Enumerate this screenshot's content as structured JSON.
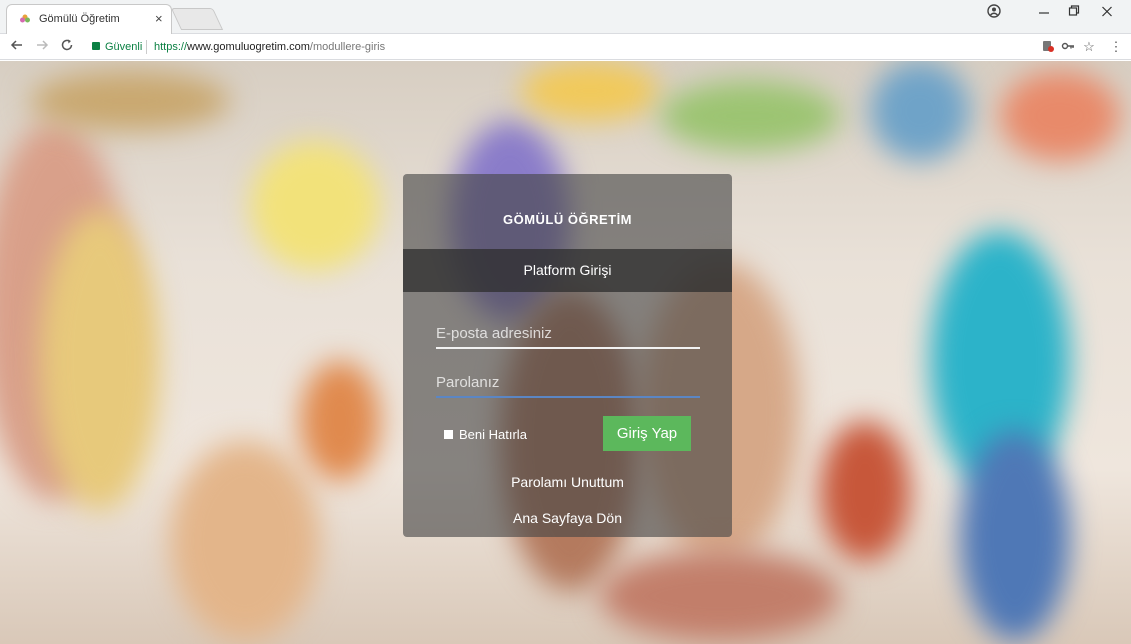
{
  "browser": {
    "tab_title": "Gömülü Öğretim",
    "tab_close": "×",
    "secure_label": "Güvenli",
    "url_scheme": "https://",
    "url_host": "www.gomuluogretim.com",
    "url_path": "/modullere-giris"
  },
  "login": {
    "brand": "GÖMÜLÜ ÖĞRETİM",
    "header": "Platform Girişi",
    "email_placeholder": "E-posta adresiniz",
    "password_placeholder": "Parolanız",
    "remember_label": "Beni Hatırla",
    "submit_label": "Giriş Yap",
    "forgot_link": "Parolamı Unuttum",
    "home_link": "Ana Sayfaya Dön"
  },
  "colors": {
    "submit_button": "#5cb85c",
    "secure": "#0b8043",
    "password_focus_underline": "#5b86c4"
  },
  "icons": {
    "back": "back-arrow-icon",
    "forward": "forward-arrow-icon",
    "reload": "reload-icon",
    "lock": "lock-icon",
    "account": "account-icon",
    "minimize": "minimize-icon",
    "maximize": "maximize-icon",
    "close": "close-icon",
    "blocked_popup": "blocked-icon",
    "key": "key-icon",
    "star": "bookmark-star-icon",
    "menu": "menu-kebab-icon"
  }
}
